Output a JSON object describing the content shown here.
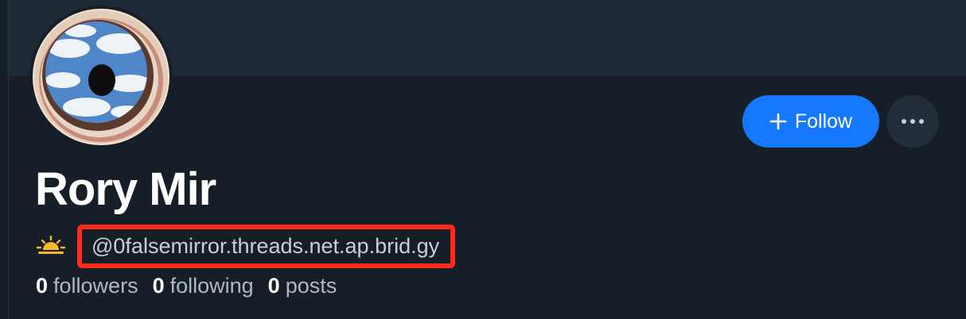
{
  "profile": {
    "display_name": "Rory Mir",
    "handle": "@0falsemirror.threads.net.ap.brid.gy",
    "status_icon": "sunrise-icon",
    "avatar_icon": "eye-clouds-avatar"
  },
  "actions": {
    "follow_label": "Follow",
    "follow_icon": "plus-icon",
    "more_icon": "ellipsis-icon"
  },
  "stats": {
    "followers_count": "0",
    "followers_label": "followers",
    "following_count": "0",
    "following_label": "following",
    "posts_count": "0",
    "posts_label": "posts"
  },
  "colors": {
    "background": "#161e27",
    "banner": "#1e2936",
    "accent": "#1677ff",
    "highlight_box": "#ff2a1a"
  }
}
